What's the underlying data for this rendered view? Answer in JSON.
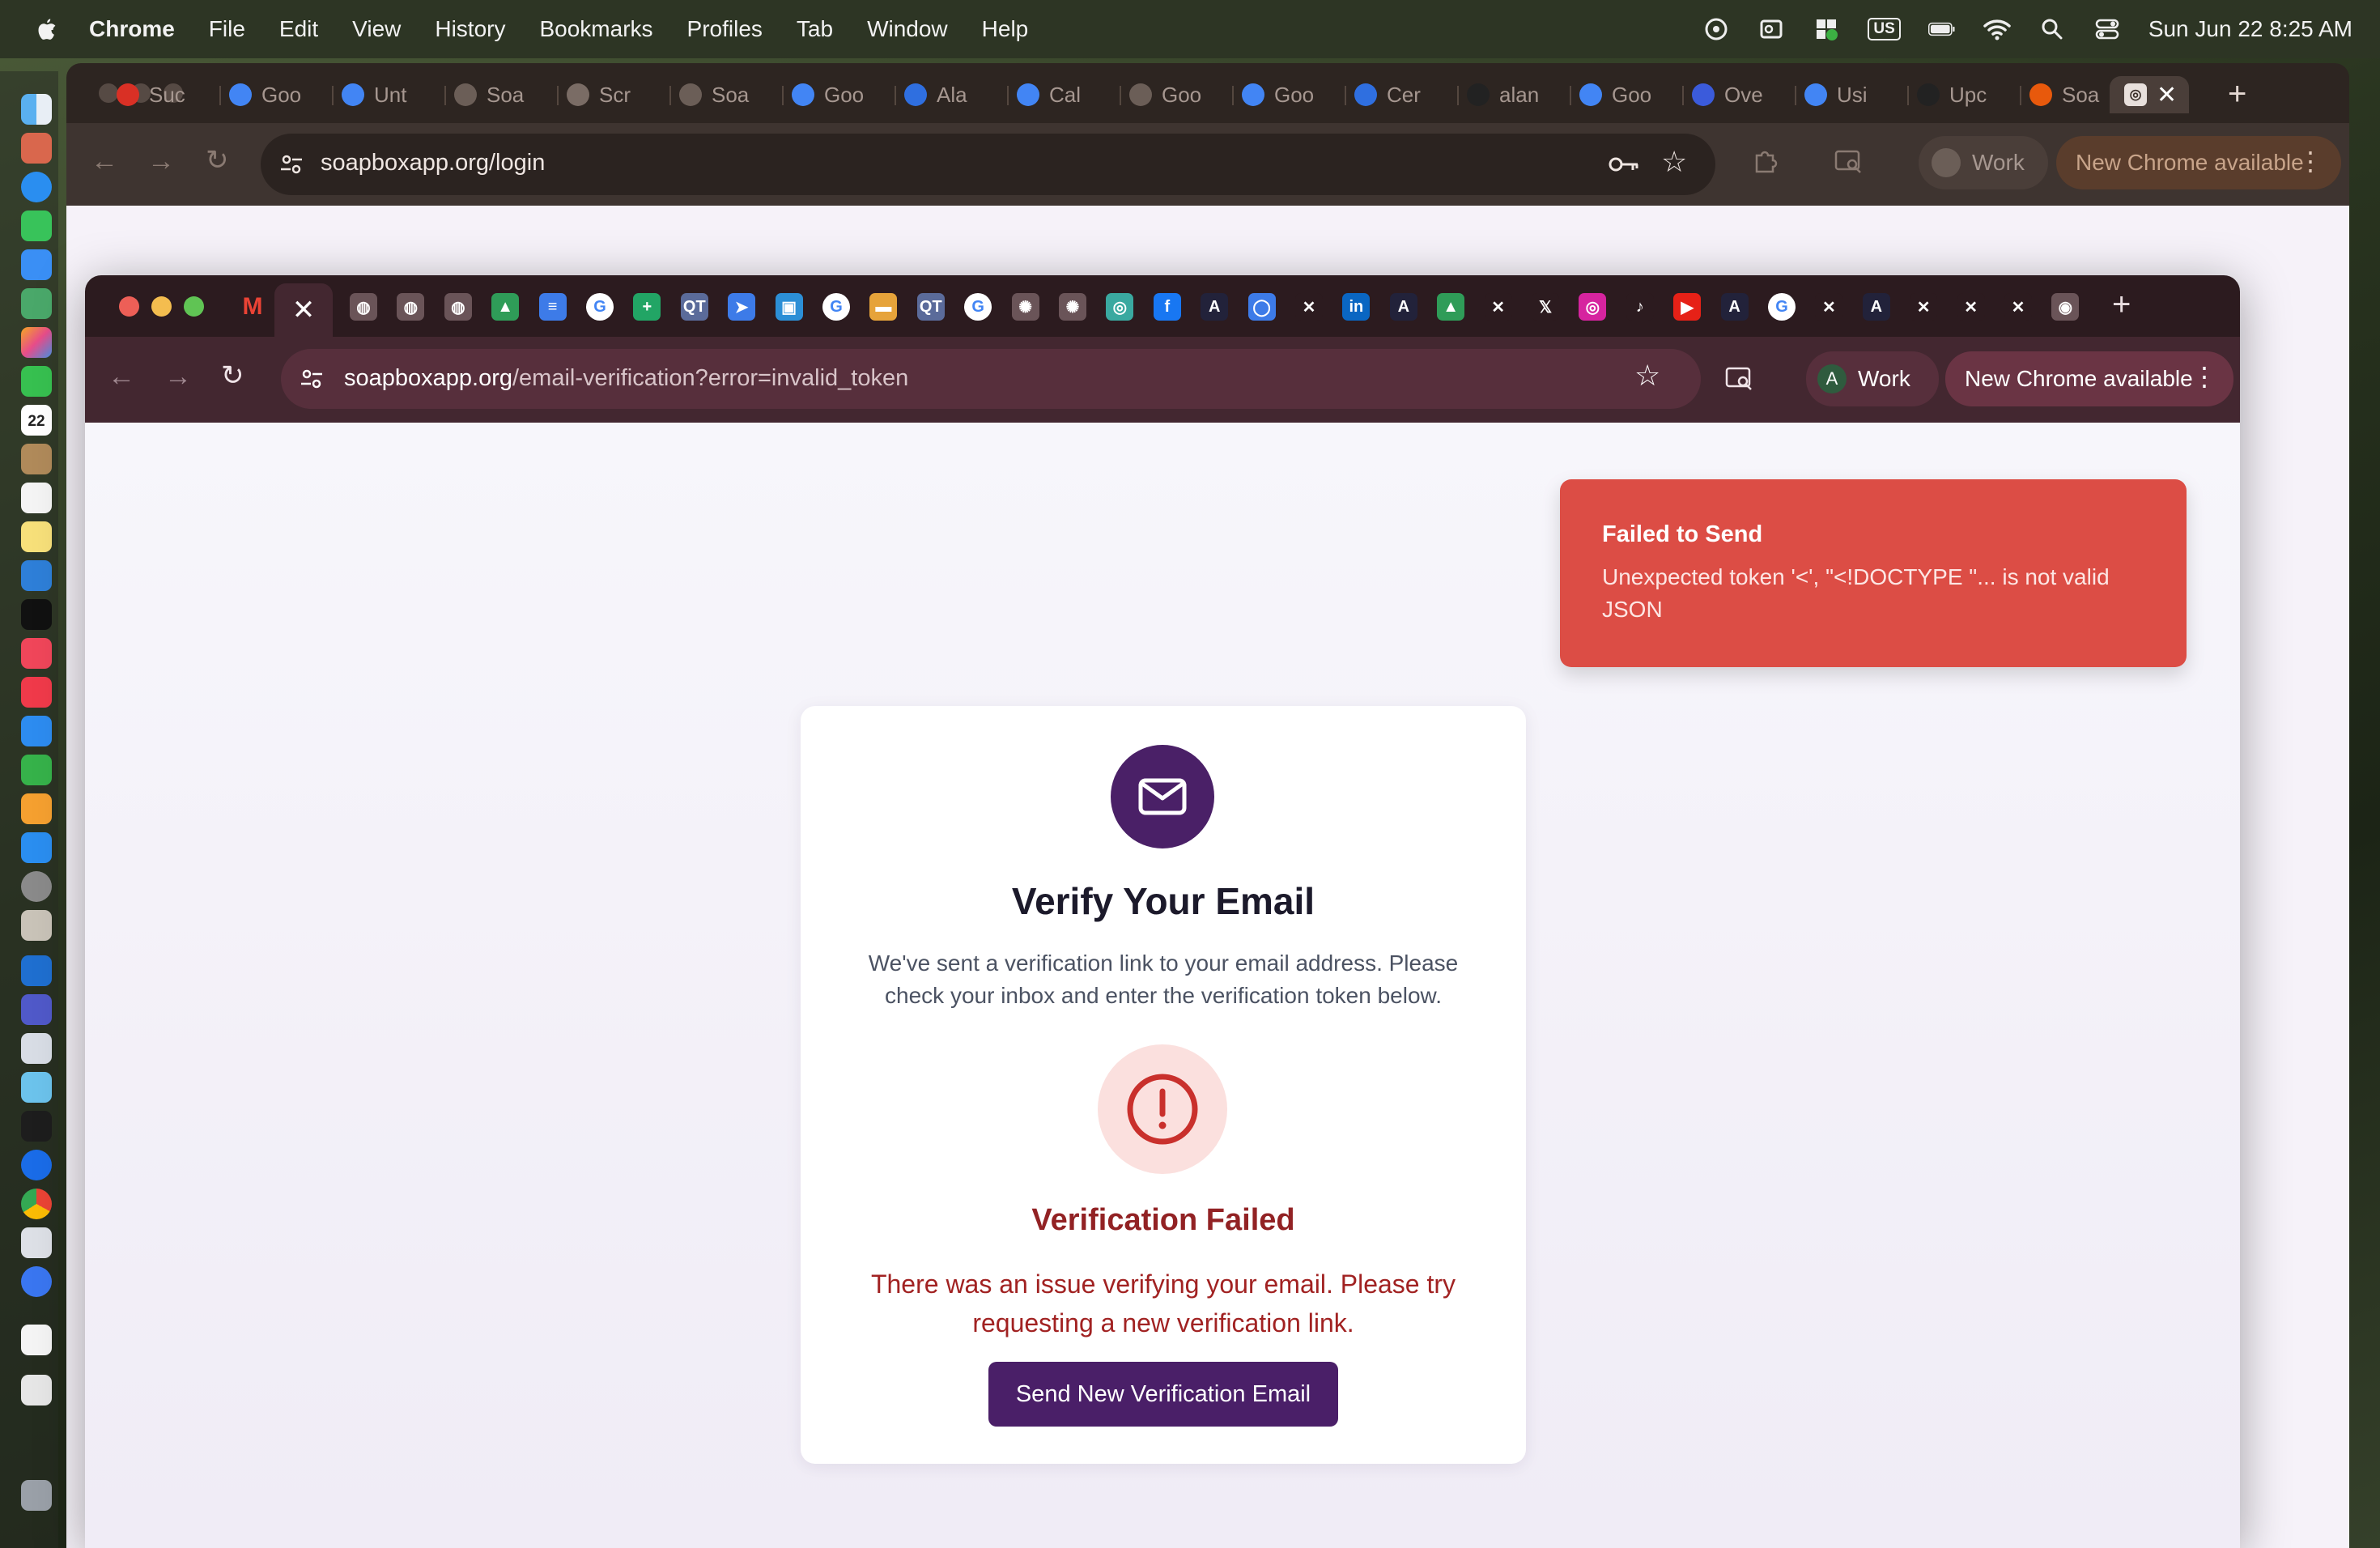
{
  "menubar": {
    "items": [
      "Chrome",
      "File",
      "Edit",
      "View",
      "History",
      "Bookmarks",
      "Profiles",
      "Tab",
      "Window",
      "Help"
    ],
    "keyboard": "US",
    "datetime": "Sun Jun 22  8:25 AM"
  },
  "dock": {
    "calendar_day": "22"
  },
  "outer_browser": {
    "tabs": [
      {
        "label": "Suc",
        "icon": "gmail-icon",
        "color": "#d93025"
      },
      {
        "label": "Goo",
        "icon": "google-icon",
        "color": "#4285f4"
      },
      {
        "label": "Unt",
        "icon": "docs-icon",
        "color": "#4285f4"
      },
      {
        "label": "Soa",
        "icon": "soapbox-icon",
        "color": "#6b5e57"
      },
      {
        "label": "Scr",
        "icon": "globe-icon",
        "color": "#7a6c65"
      },
      {
        "label": "Soa",
        "icon": "soapbox-icon",
        "color": "#6b5e57"
      },
      {
        "label": "Goo",
        "icon": "google-icon",
        "color": "#4285f4"
      },
      {
        "label": "Ala",
        "icon": "alan-icon",
        "color": "#2f6fe0"
      },
      {
        "label": "Cal",
        "icon": "docs-icon",
        "color": "#4285f4"
      },
      {
        "label": "Goo",
        "icon": "chatgpt-icon",
        "color": "#6b5e57"
      },
      {
        "label": "Goo",
        "icon": "google-icon",
        "color": "#4285f4"
      },
      {
        "label": "Cer",
        "icon": "cert-icon",
        "color": "#2f6fe0"
      },
      {
        "label": "alan",
        "icon": "github-icon",
        "color": "#222222"
      },
      {
        "label": "Goo",
        "icon": "google-icon",
        "color": "#4285f4"
      },
      {
        "label": "Ove",
        "icon": "overview-icon",
        "color": "#3b5bdb"
      },
      {
        "label": "Usi",
        "icon": "google-icon",
        "color": "#4285f4"
      },
      {
        "label": "Upc",
        "icon": "github-icon",
        "color": "#222222"
      },
      {
        "label": "Soa",
        "icon": "soap-icon",
        "color": "#e8590c"
      }
    ],
    "url": "soapboxapp.org/login",
    "profile": "Work",
    "update_label": "New Chrome available"
  },
  "inner_browser": {
    "url_host": "soapboxapp.org",
    "url_path": "/email-verification?error=invalid_token",
    "profile_initial": "A",
    "profile": "Work",
    "update_label": "New Chrome available"
  },
  "toast": {
    "title": "Failed to Send",
    "message": "Unexpected token '<', \"<!DOCTYPE \"... is not valid JSON",
    "bg_color": "#dc4d45"
  },
  "card": {
    "title": "Verify Your Email",
    "description": "We've sent a verification link to your email address. Please check your inbox and enter the verification token below.",
    "error_title": "Verification Failed",
    "error_message": "There was an issue verifying your email. Please try requesting a new verification link.",
    "button_label": "Send New Verification Email",
    "accent_color": "#4a1f68",
    "error_color": "#a12222"
  }
}
